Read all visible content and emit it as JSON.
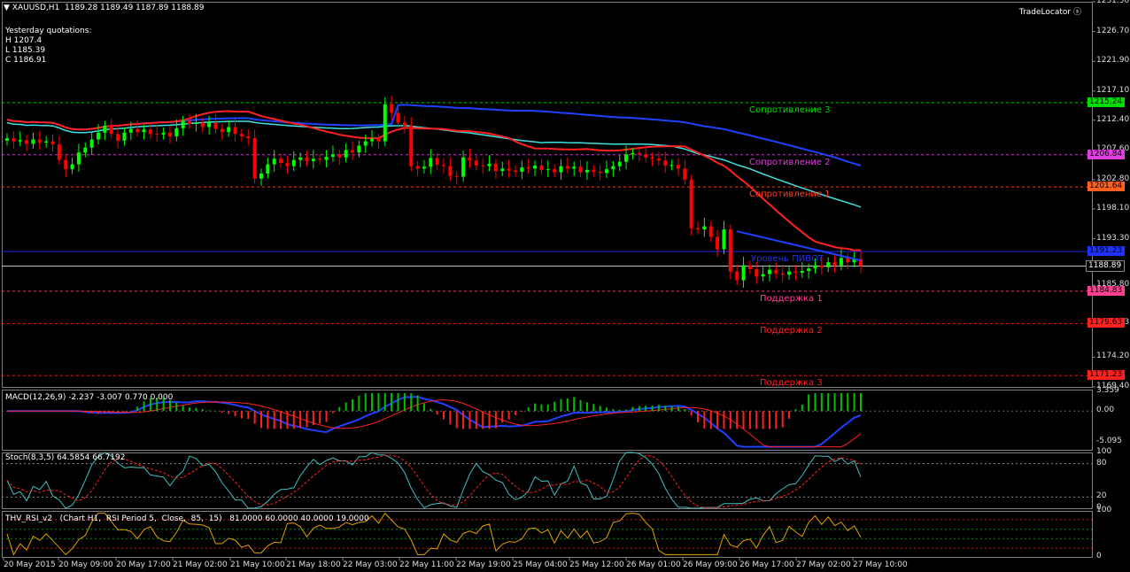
{
  "header": {
    "symbol_line": "XAUUSD,H1  1189.28 1189.49 1187.89 1188.89",
    "yesterday_title": "Yesterday quotations:",
    "high": "H 1207.4",
    "low": "L 1185.39",
    "close": "C 1186.91",
    "trade_locator": "TradeLocator"
  },
  "price_axis": {
    "ticks": [
      "1231.50",
      "1226.70",
      "1221.90",
      "1217.10",
      "1212.40",
      "1207.60",
      "1202.80",
      "1198.10",
      "1193.30",
      "1188.89",
      "1185.80",
      "1179.63",
      "1174.20",
      "1169.40"
    ],
    "current_price": "1188.89"
  },
  "levels": [
    {
      "name": "Сопротивление 3",
      "price": 1215.24,
      "tag": "1215.24",
      "color": "#00e000",
      "tagcolor": "#00e000"
    },
    {
      "name": "Сопротивление 2",
      "price": 1206.84,
      "tag": "1206.84",
      "color": "#e040e0",
      "tagcolor": "#e040e0"
    },
    {
      "name": "Сопротивление 1",
      "price": 1201.64,
      "tag": "1201.64",
      "color": "#ff4020",
      "tagcolor": "#ff6020"
    },
    {
      "name": "Уровень ПИВОТ",
      "price": 1191.23,
      "tag": "1191.23",
      "color": "#2030ff",
      "tagcolor": "#2030ff"
    },
    {
      "name": "Поддержка 1",
      "price": 1184.83,
      "tag": "1184.83",
      "color": "#ff4090",
      "tagcolor": "#ff4090"
    },
    {
      "name": "Поддержка 2",
      "price": 1179.63,
      "tag": "1179.63",
      "color": "#ff2020",
      "tagcolor": "#ff2020"
    },
    {
      "name": "Поддержка 3",
      "price": 1171.23,
      "tag": "1171.23",
      "color": "#ff2020",
      "tagcolor": "#ff2020"
    }
  ],
  "macd": {
    "label": "MACD(12,26,9) -2.237 -3.007 0.770 0.000",
    "ticks": [
      "3.359",
      "0.00",
      "-5.095"
    ]
  },
  "stoch": {
    "label": "Stoch(8,3,5) 64.5854 66.7192",
    "ticks": [
      "100",
      "80",
      "20",
      "0"
    ]
  },
  "rsi": {
    "label": "THV_RSI_v2   (Chart H1,  RSI Period 5,  Close,  85,  15)   81.0000 60.0000 40.0000 19.0000",
    "ticks": [
      "100",
      "0"
    ]
  },
  "time_axis": [
    "20 May 2015",
    "20 May 09:00",
    "20 May 17:00",
    "21 May 02:00",
    "21 May 10:00",
    "21 May 18:00",
    "22 May 03:00",
    "22 May 11:00",
    "22 May 19:00",
    "25 May 04:00",
    "25 May 12:00",
    "26 May 01:00",
    "26 May 09:00",
    "26 May 17:00",
    "27 May 02:00",
    "27 May 10:00"
  ],
  "chart_data": {
    "type": "candlestick",
    "symbol": "XAUUSD",
    "timeframe": "H1",
    "ylim": [
      1169.4,
      1231.5
    ],
    "closes": [
      1209.5,
      1209.0,
      1209.2,
      1208.6,
      1209.3,
      1208.8,
      1209.0,
      1208.5,
      1206.0,
      1204.5,
      1205.3,
      1207.2,
      1208.0,
      1209.3,
      1210.4,
      1211.5,
      1210.2,
      1209.1,
      1210.4,
      1211.0,
      1210.5,
      1210.9,
      1210.2,
      1210.1,
      1210.4,
      1209.8,
      1211.1,
      1212.3,
      1211.8,
      1212.0,
      1211.3,
      1212.0,
      1211.0,
      1210.5,
      1211.3,
      1210.2,
      1209.8,
      1209.5,
      1203.0,
      1203.8,
      1205.3,
      1206.2,
      1205.5,
      1205.0,
      1206.0,
      1206.4,
      1205.8,
      1206.2,
      1206.0,
      1206.5,
      1206.9,
      1206.4,
      1207.6,
      1207.2,
      1208.3,
      1209.0,
      1209.4,
      1209.0,
      1215.0,
      1213.6,
      1212.0,
      1211.5,
      1205.0,
      1204.6,
      1204.9,
      1206.3,
      1205.2,
      1205.0,
      1203.4,
      1203.3,
      1206.4,
      1205.9,
      1205.1,
      1205.0,
      1205.4,
      1204.2,
      1204.6,
      1204.3,
      1204.1,
      1204.8,
      1204.6,
      1205.1,
      1204.4,
      1204.5,
      1204.0,
      1205.0,
      1204.6,
      1204.9,
      1204.0,
      1204.4,
      1204.1,
      1203.9,
      1204.5,
      1205.0,
      1205.7,
      1206.9,
      1207.1,
      1206.9,
      1206.4,
      1206.2,
      1205.9,
      1205.1,
      1205.2,
      1204.6,
      1202.8,
      1195.0,
      1194.8,
      1195.3,
      1193.6,
      1191.6,
      1194.8,
      1188.0,
      1186.6,
      1189.0,
      1188.4,
      1187.2,
      1187.6,
      1188.3,
      1187.7,
      1187.5,
      1188.0,
      1187.8,
      1188.1,
      1188.5,
      1189.0,
      1188.7,
      1189.5,
      1189.0,
      1190.2,
      1189.5,
      1190.0,
      1188.9
    ],
    "indicators": [
      "MA (red)",
      "MA (blue)",
      "MA (aqua)",
      "MACD(12,26,9)",
      "Stoch(8,3,5)",
      "THV_RSI_v2"
    ]
  }
}
